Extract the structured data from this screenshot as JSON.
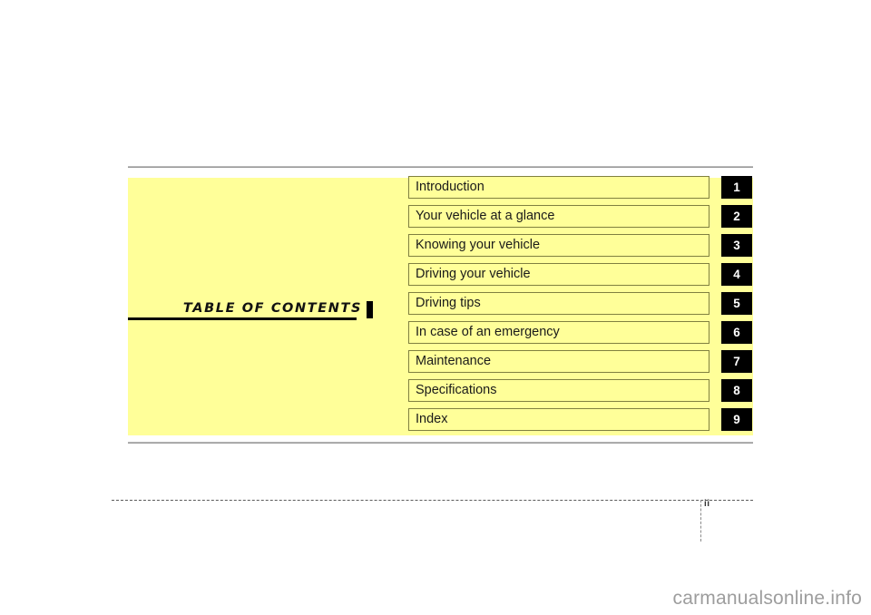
{
  "document": {
    "title": "TABLE  OF  CONTENTS",
    "page_number": "ii",
    "watermark": "carmanualsonline.info"
  },
  "colors": {
    "panel_background": "#ffff99",
    "item_border": "#808040",
    "badge_background": "#000000",
    "badge_text": "#ffffff",
    "rule": "#9a9a9a",
    "title_text": "#111111",
    "watermark_text": "#9d9d9d"
  },
  "contents": {
    "items": [
      {
        "number": "1",
        "label": "Introduction"
      },
      {
        "number": "2",
        "label": "Your vehicle at a glance"
      },
      {
        "number": "3",
        "label": "Knowing your vehicle"
      },
      {
        "number": "4",
        "label": "Driving your vehicle"
      },
      {
        "number": "5",
        "label": "Driving tips"
      },
      {
        "number": "6",
        "label": "In case of an emergency"
      },
      {
        "number": "7",
        "label": "Maintenance"
      },
      {
        "number": "8",
        "label": "Specifications"
      },
      {
        "number": "9",
        "label": "Index"
      }
    ]
  }
}
